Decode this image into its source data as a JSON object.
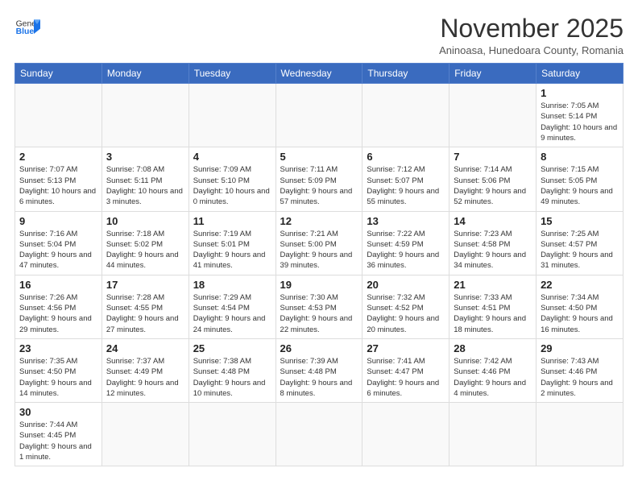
{
  "logo": {
    "text_general": "General",
    "text_blue": "Blue"
  },
  "title": "November 2025",
  "subtitle": "Aninoasa, Hunedoara County, Romania",
  "days_of_week": [
    "Sunday",
    "Monday",
    "Tuesday",
    "Wednesday",
    "Thursday",
    "Friday",
    "Saturday"
  ],
  "weeks": [
    [
      null,
      null,
      null,
      null,
      null,
      null,
      {
        "day": "1",
        "info": "Sunrise: 7:05 AM\nSunset: 5:14 PM\nDaylight: 10 hours and 9 minutes."
      }
    ],
    [
      {
        "day": "2",
        "info": "Sunrise: 7:07 AM\nSunset: 5:13 PM\nDaylight: 10 hours and 6 minutes."
      },
      {
        "day": "3",
        "info": "Sunrise: 7:08 AM\nSunset: 5:11 PM\nDaylight: 10 hours and 3 minutes."
      },
      {
        "day": "4",
        "info": "Sunrise: 7:09 AM\nSunset: 5:10 PM\nDaylight: 10 hours and 0 minutes."
      },
      {
        "day": "5",
        "info": "Sunrise: 7:11 AM\nSunset: 5:09 PM\nDaylight: 9 hours and 57 minutes."
      },
      {
        "day": "6",
        "info": "Sunrise: 7:12 AM\nSunset: 5:07 PM\nDaylight: 9 hours and 55 minutes."
      },
      {
        "day": "7",
        "info": "Sunrise: 7:14 AM\nSunset: 5:06 PM\nDaylight: 9 hours and 52 minutes."
      },
      {
        "day": "8",
        "info": "Sunrise: 7:15 AM\nSunset: 5:05 PM\nDaylight: 9 hours and 49 minutes."
      }
    ],
    [
      {
        "day": "9",
        "info": "Sunrise: 7:16 AM\nSunset: 5:04 PM\nDaylight: 9 hours and 47 minutes."
      },
      {
        "day": "10",
        "info": "Sunrise: 7:18 AM\nSunset: 5:02 PM\nDaylight: 9 hours and 44 minutes."
      },
      {
        "day": "11",
        "info": "Sunrise: 7:19 AM\nSunset: 5:01 PM\nDaylight: 9 hours and 41 minutes."
      },
      {
        "day": "12",
        "info": "Sunrise: 7:21 AM\nSunset: 5:00 PM\nDaylight: 9 hours and 39 minutes."
      },
      {
        "day": "13",
        "info": "Sunrise: 7:22 AM\nSunset: 4:59 PM\nDaylight: 9 hours and 36 minutes."
      },
      {
        "day": "14",
        "info": "Sunrise: 7:23 AM\nSunset: 4:58 PM\nDaylight: 9 hours and 34 minutes."
      },
      {
        "day": "15",
        "info": "Sunrise: 7:25 AM\nSunset: 4:57 PM\nDaylight: 9 hours and 31 minutes."
      }
    ],
    [
      {
        "day": "16",
        "info": "Sunrise: 7:26 AM\nSunset: 4:56 PM\nDaylight: 9 hours and 29 minutes."
      },
      {
        "day": "17",
        "info": "Sunrise: 7:28 AM\nSunset: 4:55 PM\nDaylight: 9 hours and 27 minutes."
      },
      {
        "day": "18",
        "info": "Sunrise: 7:29 AM\nSunset: 4:54 PM\nDaylight: 9 hours and 24 minutes."
      },
      {
        "day": "19",
        "info": "Sunrise: 7:30 AM\nSunset: 4:53 PM\nDaylight: 9 hours and 22 minutes."
      },
      {
        "day": "20",
        "info": "Sunrise: 7:32 AM\nSunset: 4:52 PM\nDaylight: 9 hours and 20 minutes."
      },
      {
        "day": "21",
        "info": "Sunrise: 7:33 AM\nSunset: 4:51 PM\nDaylight: 9 hours and 18 minutes."
      },
      {
        "day": "22",
        "info": "Sunrise: 7:34 AM\nSunset: 4:50 PM\nDaylight: 9 hours and 16 minutes."
      }
    ],
    [
      {
        "day": "23",
        "info": "Sunrise: 7:35 AM\nSunset: 4:50 PM\nDaylight: 9 hours and 14 minutes."
      },
      {
        "day": "24",
        "info": "Sunrise: 7:37 AM\nSunset: 4:49 PM\nDaylight: 9 hours and 12 minutes."
      },
      {
        "day": "25",
        "info": "Sunrise: 7:38 AM\nSunset: 4:48 PM\nDaylight: 9 hours and 10 minutes."
      },
      {
        "day": "26",
        "info": "Sunrise: 7:39 AM\nSunset: 4:48 PM\nDaylight: 9 hours and 8 minutes."
      },
      {
        "day": "27",
        "info": "Sunrise: 7:41 AM\nSunset: 4:47 PM\nDaylight: 9 hours and 6 minutes."
      },
      {
        "day": "28",
        "info": "Sunrise: 7:42 AM\nSunset: 4:46 PM\nDaylight: 9 hours and 4 minutes."
      },
      {
        "day": "29",
        "info": "Sunrise: 7:43 AM\nSunset: 4:46 PM\nDaylight: 9 hours and 2 minutes."
      }
    ],
    [
      {
        "day": "30",
        "info": "Sunrise: 7:44 AM\nSunset: 4:45 PM\nDaylight: 9 hours and 1 minute."
      },
      null,
      null,
      null,
      null,
      null,
      null
    ]
  ]
}
